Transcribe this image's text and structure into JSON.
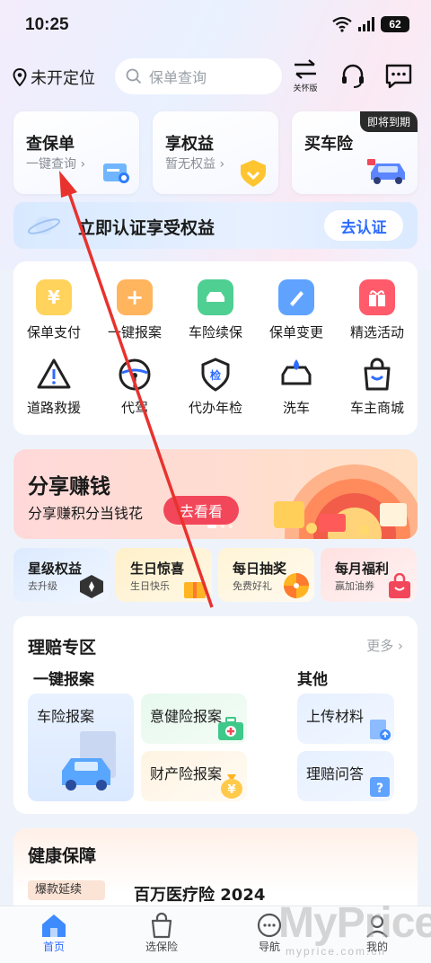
{
  "status_bar": {
    "time": "10:25",
    "battery": "62"
  },
  "header": {
    "location": "未开定位",
    "search_placeholder": "保单查询",
    "care_mode_label": "关怀版"
  },
  "top_cards": [
    {
      "title": "查保单",
      "subtitle": "一键查询"
    },
    {
      "title": "享权益",
      "subtitle": "暂无权益"
    },
    {
      "title": "买车险",
      "badge": "即将到期"
    }
  ],
  "verify_banner": {
    "text": "立即认证享受权益",
    "button": "去认证"
  },
  "services": [
    {
      "label": "保单支付",
      "icon": "yen-wallet-icon",
      "color": "#f5b523"
    },
    {
      "label": "一键报案",
      "icon": "report-plus-icon",
      "color": "#ff9a3c"
    },
    {
      "label": "车险续保",
      "icon": "car-renew-icon",
      "color": "#2fb67c"
    },
    {
      "label": "保单变更",
      "icon": "edit-policy-icon",
      "color": "#3d8bff"
    },
    {
      "label": "精选活动",
      "icon": "gift-icon",
      "color": "#f2475a"
    },
    {
      "label": "道路救援",
      "icon": "warning-triangle-icon",
      "color": "#222222"
    },
    {
      "label": "代驾",
      "icon": "steering-wheel-icon",
      "color": "#222222"
    },
    {
      "label": "代办年检",
      "icon": "inspection-shield-icon",
      "color": "#222222"
    },
    {
      "label": "洗车",
      "icon": "car-wash-icon",
      "color": "#222222"
    },
    {
      "label": "车主商城",
      "icon": "shopping-bag-icon",
      "color": "#222222"
    }
  ],
  "promo": {
    "title": "分享赚钱",
    "subtitle": "分享赚积分当钱花",
    "button": "去看看"
  },
  "mini_cards": [
    {
      "title": "星级权益",
      "subtitle": "去升级"
    },
    {
      "title": "生日惊喜",
      "subtitle": "生日快乐"
    },
    {
      "title": "每日抽奖",
      "subtitle": "免费好礼"
    },
    {
      "title": "每月福利",
      "subtitle": "赢加油券"
    }
  ],
  "claims": {
    "title": "理赔专区",
    "more": "更多",
    "left_heading": "一键报案",
    "right_heading": "其他",
    "items": [
      "车险报案",
      "意健险报案",
      "财产险报案",
      "上传材料",
      "理赔问答"
    ]
  },
  "health": {
    "title": "健康保障",
    "tag": "爆款延续",
    "product": "百万医疗险 2024"
  },
  "tabs": [
    {
      "label": "首页",
      "active": true
    },
    {
      "label": "选保险",
      "active": false
    },
    {
      "label": "导航",
      "active": false
    },
    {
      "label": "我的",
      "active": false
    }
  ],
  "watermark": {
    "brand": "MyPrice",
    "url": "myprice.com.cn"
  }
}
